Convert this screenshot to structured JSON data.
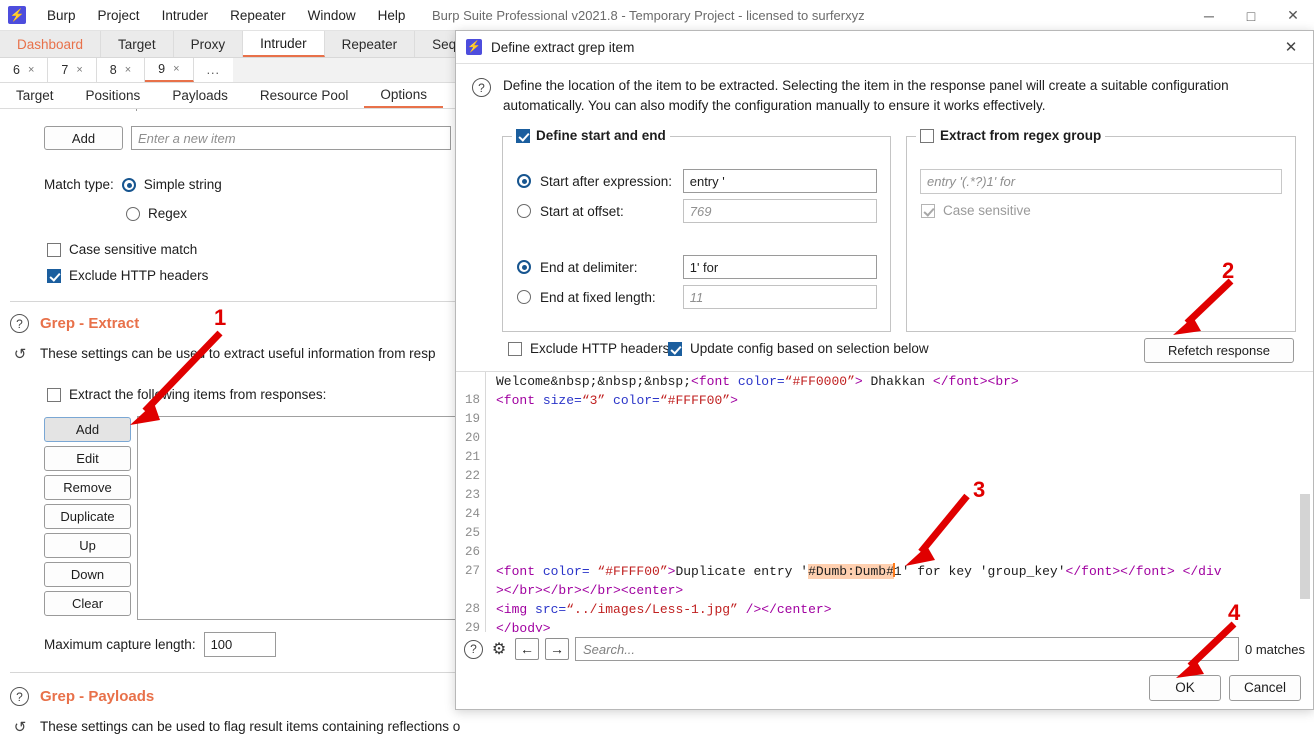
{
  "window": {
    "title": "Burp Suite Professional v2021.8 - Temporary Project - licensed to surferxyz",
    "logo_glyph": "⚡",
    "minimize": "─",
    "maximize": "□",
    "close": "✕"
  },
  "menu": {
    "items": [
      "Burp",
      "Project",
      "Intruder",
      "Repeater",
      "Window",
      "Help"
    ]
  },
  "main_tabs": [
    {
      "label": "Dashboard",
      "active": false,
      "accent": true
    },
    {
      "label": "Target",
      "active": false,
      "accent": false
    },
    {
      "label": "Proxy",
      "active": false,
      "accent": false
    },
    {
      "label": "Intruder",
      "active": true,
      "accent": false
    },
    {
      "label": "Repeater",
      "active": false,
      "accent": false
    },
    {
      "label": "Sequ",
      "active": false,
      "accent": false
    }
  ],
  "num_tabs": [
    {
      "label": "6",
      "close": "×",
      "active": false
    },
    {
      "label": "7",
      "close": "×",
      "active": false
    },
    {
      "label": "8",
      "close": "×",
      "active": false
    },
    {
      "label": "9",
      "close": "×",
      "active": true
    }
  ],
  "num_tabs_more": "...",
  "option_tabs": [
    {
      "label": "Target",
      "active": false
    },
    {
      "label": "Positions",
      "active": false
    },
    {
      "label": "Payloads",
      "active": false
    },
    {
      "label": "Resource Pool",
      "active": false
    },
    {
      "label": "Options",
      "active": true
    }
  ],
  "left_panel": {
    "add_button": "Add",
    "new_item_placeholder": "Enter a new item",
    "match_type_label": "Match type:",
    "match_simple_string": "Simple string",
    "match_regex": "Regex",
    "case_sensitive_match": "Case sensitive match",
    "exclude_http_headers": "Exclude HTTP headers",
    "grep_extract": {
      "title": "Grep - Extract",
      "description": "These settings can be used to extract useful information from resp",
      "checkbox_label": "Extract the following items from responses:",
      "buttons": [
        "Add",
        "Edit",
        "Remove",
        "Duplicate",
        "Up",
        "Down",
        "Clear"
      ],
      "max_capture_label": "Maximum capture length:",
      "max_capture_value": "100"
    },
    "grep_payloads": {
      "title": "Grep - Payloads",
      "description": "These settings can be used to flag result items containing reflections of the submitted payload."
    }
  },
  "dialog": {
    "title": "Define extract grep item",
    "logo_glyph": "⚡",
    "close_glyph": "✕",
    "help_glyph": "?",
    "description": "Define the location of the item to be extracted. Selecting the item in the response panel will create a suitable configuration automatically. You can also modify the configuration manually to ensure it works effectively.",
    "start_end": {
      "legend": "Define start and end",
      "legend_checked": true,
      "start_after_expression_label": "Start after expression:",
      "start_after_expression_value": "entry '",
      "start_after_expression_selected": true,
      "start_at_offset_label": "Start at offset:",
      "start_at_offset_value": "769",
      "start_at_offset_selected": false,
      "end_at_delimiter_label": "End at delimiter:",
      "end_at_delimiter_value": "1' for",
      "end_at_delimiter_selected": true,
      "end_at_fixed_length_label": "End at fixed length:",
      "end_at_fixed_length_value": "11",
      "end_at_fixed_length_selected": false
    },
    "regex_group": {
      "legend": "Extract from regex group",
      "legend_checked": false,
      "pattern_placeholder": "entry '(.*?)1' for",
      "case_sensitive_label": "Case sensitive",
      "case_sensitive_checked": true
    },
    "options_row": {
      "exclude_http_headers": "Exclude HTTP headers",
      "exclude_http_headers_checked": false,
      "update_config": "Update config based on selection below",
      "update_config_checked": true,
      "refetch_button": "Refetch response"
    },
    "search": {
      "placeholder": "Search...",
      "value": "",
      "matches": "0 matches",
      "help_glyph": "?",
      "gear_glyph": "⚙",
      "prev_glyph": "←",
      "next_glyph": "→"
    },
    "footer": {
      "ok": "OK",
      "cancel": "Cancel"
    },
    "code": {
      "lines": [
        {
          "num": "",
          "tokens": [
            {
              "t": "Welcome&nbsp;&nbsp;&nbsp;",
              "c": "tx"
            },
            {
              "t": "<font ",
              "c": "tg"
            },
            {
              "t": "color=",
              "c": "at"
            },
            {
              "t": "“#FF0000”",
              "c": "vl"
            },
            {
              "t": "> ",
              "c": "tg"
            },
            {
              "t": "Dhakkan ",
              "c": "tx"
            },
            {
              "t": "</font><br>",
              "c": "tg"
            }
          ]
        },
        {
          "num": "18",
          "tokens": [
            {
              "t": "<font ",
              "c": "tg"
            },
            {
              "t": "size=",
              "c": "at"
            },
            {
              "t": "“3”",
              "c": "vl"
            },
            {
              "t": " ",
              "c": "tx"
            },
            {
              "t": "color=",
              "c": "at"
            },
            {
              "t": "“#FFFF00”",
              "c": "vl"
            },
            {
              "t": ">",
              "c": "tg"
            }
          ]
        },
        {
          "num": "19",
          "tokens": []
        },
        {
          "num": "20",
          "tokens": []
        },
        {
          "num": "21",
          "tokens": []
        },
        {
          "num": "22",
          "tokens": []
        },
        {
          "num": "23",
          "tokens": []
        },
        {
          "num": "24",
          "tokens": []
        },
        {
          "num": "25",
          "tokens": []
        },
        {
          "num": "26",
          "tokens": []
        },
        {
          "num": "27",
          "tokens": [
            {
              "t": "<font ",
              "c": "tg"
            },
            {
              "t": "color=",
              "c": "at"
            },
            {
              "t": " “#FFFF00”",
              "c": "vl"
            },
            {
              "t": ">",
              "c": "tg"
            },
            {
              "t": "Duplicate entry '",
              "c": "tx"
            },
            {
              "t": "#Dumb:Dumb#",
              "c": "tx sel"
            },
            {
              "t": "|CARET|",
              "c": "caret"
            },
            {
              "t": "1' for key 'group_key'",
              "c": "tx"
            },
            {
              "t": "</font></font>",
              "c": "tg"
            },
            {
              "t": " ",
              "c": "tx"
            },
            {
              "t": "</div",
              "c": "tg"
            }
          ]
        },
        {
          "num": "",
          "tokens": [
            {
              "t": "></br></br></br>",
              "c": "tg"
            },
            {
              "t": "<center>",
              "c": "tg"
            }
          ]
        },
        {
          "num": "28",
          "tokens": [
            {
              "t": "<img ",
              "c": "tg"
            },
            {
              "t": "src=",
              "c": "at"
            },
            {
              "t": "“../images/Less-1.jpg”",
              "c": "vl"
            },
            {
              "t": " />",
              "c": "tg"
            },
            {
              "t": "</center>",
              "c": "tg"
            }
          ]
        },
        {
          "num": "29",
          "tokens": [
            {
              "t": "</body>",
              "c": "tg"
            }
          ]
        }
      ]
    }
  },
  "annotations": [
    {
      "label": "1"
    },
    {
      "label": "2"
    },
    {
      "label": "3"
    },
    {
      "label": "4"
    }
  ],
  "colors": {
    "accent_orange": "#e8714a",
    "annotation_red": "#e00000",
    "selection_peach": "#ffd0b0",
    "caret_orange": "#ff7a1a",
    "radio_blue": "#17558f",
    "checkbox_blue": "#1b5e9e"
  }
}
